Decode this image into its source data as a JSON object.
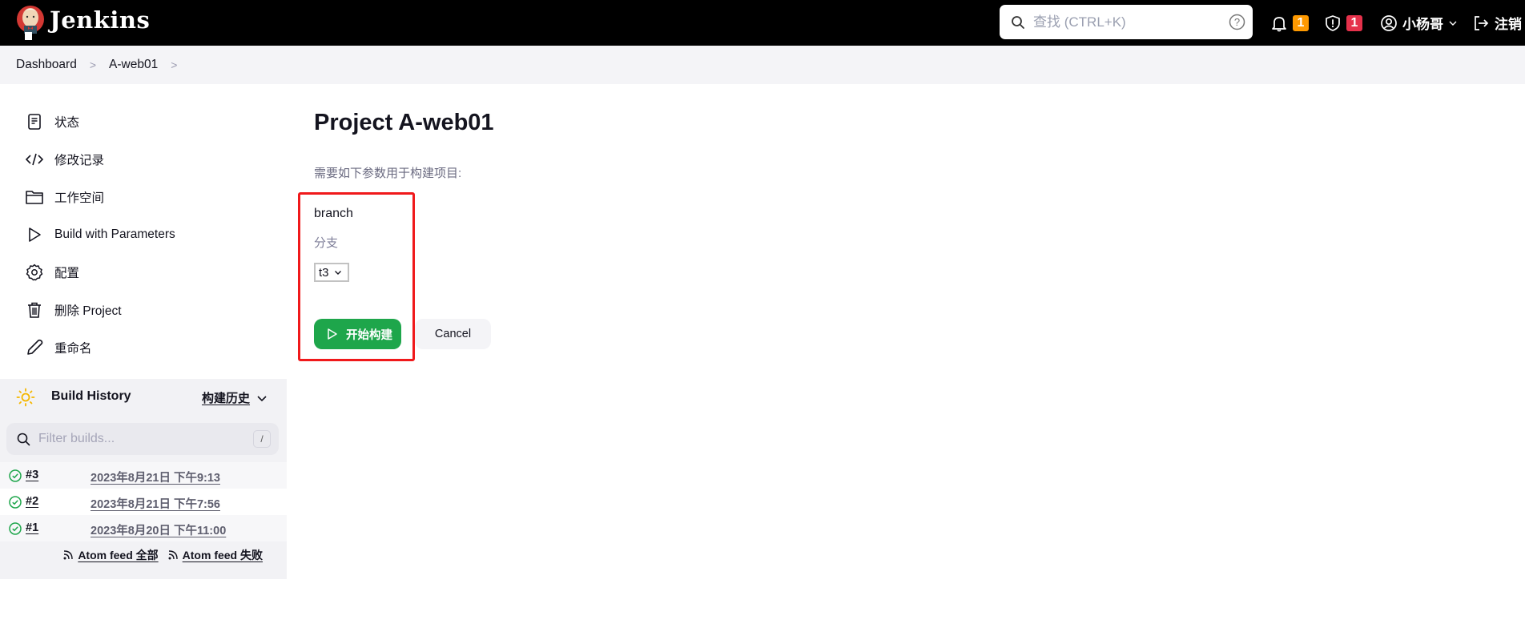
{
  "header": {
    "brand": "Jenkins",
    "search_placeholder": "查找 (CTRL+K)",
    "notifications_count": "1",
    "security_count": "1",
    "user_name": "小杨哥",
    "logout_label": "注销",
    "colors": {
      "notification_badge": "#fe9900",
      "security_badge": "#e5314b"
    }
  },
  "breadcrumb": [
    {
      "label": "Dashboard"
    },
    {
      "label": "A-web01"
    }
  ],
  "sidebar": {
    "items": [
      {
        "label": "状态",
        "icon": "document-icon"
      },
      {
        "label": "修改记录",
        "icon": "code-icon"
      },
      {
        "label": "工作空间",
        "icon": "folder-icon"
      },
      {
        "label": "Build with Parameters",
        "icon": "play-icon"
      },
      {
        "label": "配置",
        "icon": "gear-icon"
      },
      {
        "label": "删除 Project",
        "icon": "trash-icon"
      },
      {
        "label": "重命名",
        "icon": "pencil-icon"
      }
    ]
  },
  "build_history": {
    "title": "Build History",
    "trend_label": "构建历史",
    "filter_placeholder": "Filter builds...",
    "filter_shortcut": "/",
    "builds": [
      {
        "number": "#3",
        "time": "2023年8月21日 下午9:13",
        "status": "success"
      },
      {
        "number": "#2",
        "time": "2023年8月21日 下午7:56",
        "status": "success"
      },
      {
        "number": "#1",
        "time": "2023年8月20日 下午11:00",
        "status": "success"
      }
    ],
    "feeds": [
      {
        "label": "Atom feed 全部"
      },
      {
        "label": "Atom feed 失败"
      }
    ]
  },
  "main": {
    "title": "Project A-web01",
    "description": "需要如下参数用于构建项目:",
    "parameter": {
      "name": "branch",
      "description": "分支",
      "selected_value": "t3"
    },
    "build_button_label": "开始构建",
    "cancel_button_label": "Cancel",
    "colors": {
      "build_button": "#1ea64b",
      "highlight_box": "#f0191b"
    }
  }
}
